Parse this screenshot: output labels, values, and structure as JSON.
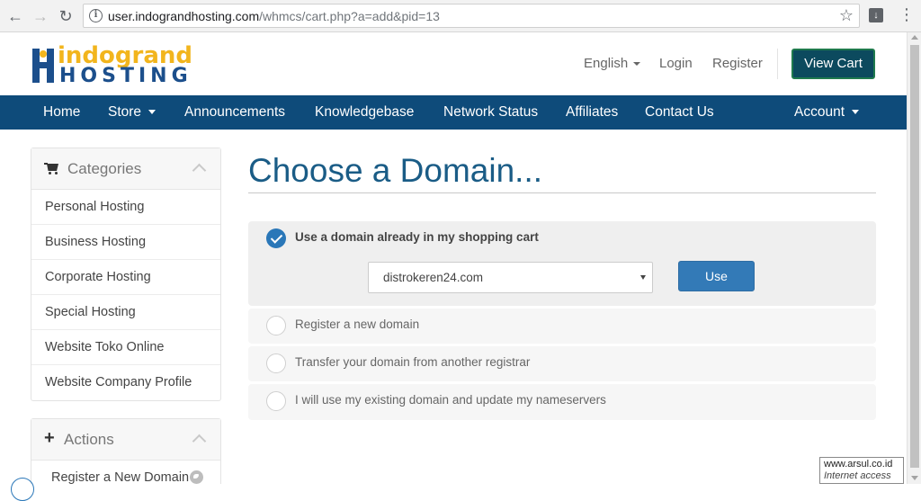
{
  "browser": {
    "url_host": "user.indograndhosting.com",
    "url_path": "/whmcs/cart.php?a=add&pid=13"
  },
  "header": {
    "logo_line1": "indogrand",
    "logo_line2": "HOSTING",
    "language": "English",
    "login": "Login",
    "register": "Register",
    "view_cart": "View Cart"
  },
  "navbar": {
    "items": [
      "Home",
      "Store",
      "Announcements",
      "Knowledgebase",
      "Network Status",
      "Affiliates",
      "Contact Us"
    ],
    "account": "Account"
  },
  "sidebar": {
    "categories_title": "Categories",
    "categories": [
      "Personal Hosting",
      "Business Hosting",
      "Corporate Hosting",
      "Special Hosting",
      "Website Toko Online",
      "Website Company Profile"
    ],
    "actions_title": "Actions",
    "actions": [
      "Register a New Domain"
    ]
  },
  "main": {
    "title": "Choose a Domain...",
    "options": [
      {
        "label": "Use a domain already in my shopping cart",
        "selected": true
      },
      {
        "label": "Register a new domain",
        "selected": false
      },
      {
        "label": "Transfer your domain from another registrar",
        "selected": false
      },
      {
        "label": "I will use my existing domain and update my nameservers",
        "selected": false
      }
    ],
    "domain_select": "distrokeren24.com",
    "use_button": "Use"
  },
  "status_tip": {
    "line1": "www.arsul.co.id",
    "line2": "Internet access"
  },
  "colors": {
    "brand_blue": "#0e4b7a",
    "brand_yellow": "#f2b51d",
    "title_blue": "#1a5c86",
    "button_blue": "#337ab7"
  }
}
